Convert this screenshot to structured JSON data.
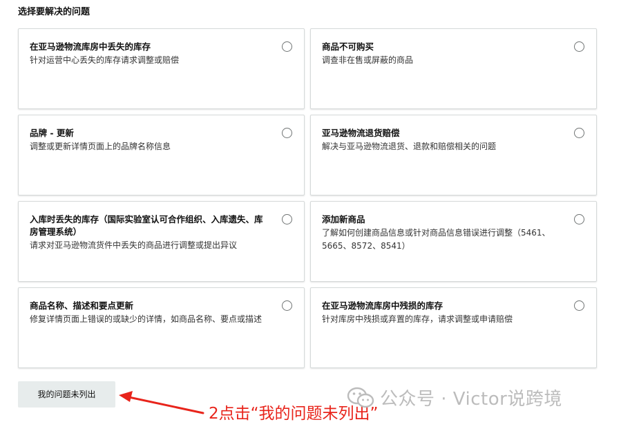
{
  "heading": "选择要解决的问题",
  "options": [
    {
      "title": "在亚马逊物流库房中丢失的库存",
      "desc": "针对运营中心丢失的库存请求调整或赔偿"
    },
    {
      "title": "商品不可购买",
      "desc": "调查非在售或屏蔽的商品"
    },
    {
      "title": "品牌 - 更新",
      "desc": "调整或更新详情页面上的品牌名称信息"
    },
    {
      "title": "亚马逊物流退货赔偿",
      "desc": "解决与亚马逊物流退货、退款和赔偿相关的问题"
    },
    {
      "title": "入库时丢失的库存（国际实验室认可合作组织、入库遗失、库房管理系统）",
      "desc": "请求对亚马逊物流货件中丢失的商品进行调整或提出异议"
    },
    {
      "title": "添加新商品",
      "desc": "了解如何创建商品信息或针对商品信息错误进行调整（5461、5665、8572、8541）"
    },
    {
      "title": "商品名称、描述和要点更新",
      "desc": "修复详情页面上错误的或缺少的详情，如商品名称、要点或描述"
    },
    {
      "title": "在亚马逊物流库房中残损的库存",
      "desc": "针对库房中残损或弃置的库存，请求调整或申请赔偿"
    }
  ],
  "not_listed_button": "我的问题未列出",
  "annotation": {
    "text": "2点击“我的问题未列出”",
    "color": "#e8241b"
  },
  "watermark": {
    "text": "公众号 · Victor说跨境",
    "logo_icon": "wechat-icon"
  }
}
